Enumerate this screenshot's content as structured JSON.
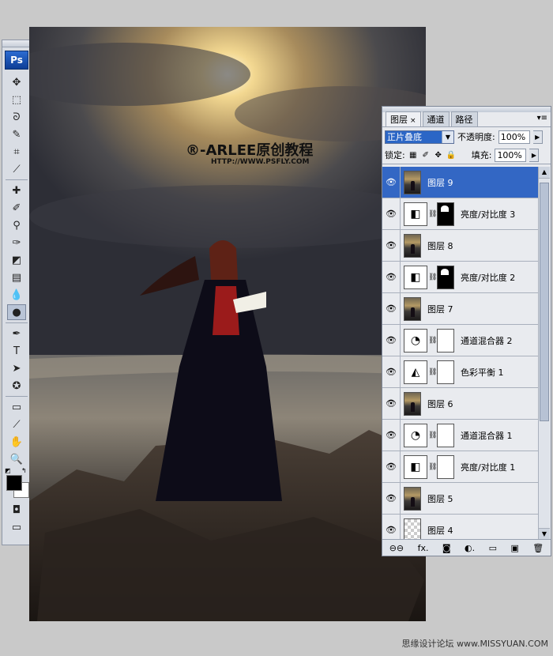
{
  "app": {
    "logo": "Ps"
  },
  "tools": {
    "items": [
      {
        "name": "move-tool-icon",
        "glyph": "✥"
      },
      {
        "name": "marquee-tool-icon",
        "glyph": "⬚"
      },
      {
        "name": "lasso-tool-icon",
        "glyph": "ᘐ"
      },
      {
        "name": "quick-select-tool-icon",
        "glyph": "✎"
      },
      {
        "name": "crop-tool-icon",
        "glyph": "⌗"
      },
      {
        "name": "eyedropper-slice-tool-icon",
        "glyph": "⟋"
      },
      {
        "name": "sep"
      },
      {
        "name": "healing-brush-tool-icon",
        "glyph": "✚"
      },
      {
        "name": "brush-tool-icon",
        "glyph": "✐"
      },
      {
        "name": "clone-stamp-tool-icon",
        "glyph": "⚲"
      },
      {
        "name": "history-brush-tool-icon",
        "glyph": "✑"
      },
      {
        "name": "eraser-tool-icon",
        "glyph": "◩"
      },
      {
        "name": "gradient-tool-icon",
        "glyph": "▤"
      },
      {
        "name": "blur-tool-icon",
        "glyph": "💧"
      },
      {
        "name": "dodge-tool-icon",
        "glyph": "●",
        "selected": true
      },
      {
        "name": "sep"
      },
      {
        "name": "pen-tool-icon",
        "glyph": "✒"
      },
      {
        "name": "type-tool-icon",
        "glyph": "T"
      },
      {
        "name": "path-select-tool-icon",
        "glyph": "➤"
      },
      {
        "name": "shape-tool-icon",
        "glyph": "✪"
      },
      {
        "name": "sep"
      },
      {
        "name": "notes-tool-icon",
        "glyph": "▭"
      },
      {
        "name": "eyedropper-tool-icon",
        "glyph": "⟋"
      },
      {
        "name": "hand-tool-icon",
        "glyph": "✋"
      },
      {
        "name": "zoom-tool-icon",
        "glyph": "🔍"
      }
    ]
  },
  "canvas": {
    "watermark_title": "®-ARLEE原创教程",
    "watermark_url": "HTTP://WWW.PSFLY.COM"
  },
  "layers_panel": {
    "tabs": [
      {
        "label": "图层",
        "active": true,
        "close": "×"
      },
      {
        "label": "通道",
        "active": false
      },
      {
        "label": "路径",
        "active": false
      }
    ],
    "menu_glyph": "▾≡",
    "blend_mode": "正片叠底",
    "opacity_label": "不透明度:",
    "opacity_value": "100%",
    "lock_label": "锁定:",
    "fill_label": "填充:",
    "fill_value": "100%",
    "layers": [
      {
        "name": "图层 9",
        "kind": "photo",
        "selected": true
      },
      {
        "name": "亮度/对比度 3",
        "kind": "brightness",
        "mask": "dark"
      },
      {
        "name": "图层 8",
        "kind": "photo"
      },
      {
        "name": "亮度/对比度 2",
        "kind": "brightness",
        "mask": "dark"
      },
      {
        "name": "图层 7",
        "kind": "photo"
      },
      {
        "name": "通道混合器 2",
        "kind": "mixer",
        "mask": "white"
      },
      {
        "name": "色彩平衡 1",
        "kind": "balance",
        "mask": "white"
      },
      {
        "name": "图层 6",
        "kind": "photo"
      },
      {
        "name": "通道混合器 1",
        "kind": "mixer",
        "mask": "white"
      },
      {
        "name": "亮度/对比度 1",
        "kind": "brightness",
        "mask": "white"
      },
      {
        "name": "图层 5",
        "kind": "photo"
      },
      {
        "name": "图层 4",
        "kind": "empty"
      }
    ],
    "bottom_icons": [
      "link-layers-icon",
      "fx-icon",
      "add-mask-icon",
      "adjustment-layer-icon",
      "new-group-icon",
      "new-layer-icon",
      "delete-layer-icon"
    ],
    "bottom_glyphs": [
      "⊖⊖",
      "fx.",
      "◙",
      "◐.",
      "▭",
      "▣",
      "🗑"
    ]
  },
  "footer": {
    "credit": "思缘设计论坛 www.MISSYUAN.COM"
  }
}
